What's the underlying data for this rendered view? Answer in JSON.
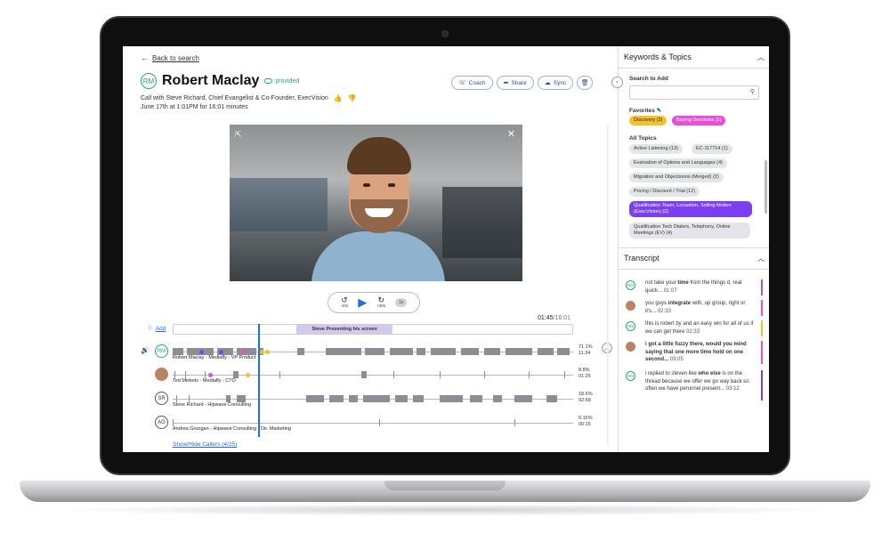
{
  "back": {
    "arrow": "←",
    "label": "Back to search"
  },
  "header": {
    "initials": "RM",
    "name": "Robert Maclay",
    "provided": "provided",
    "call_info": "Call with Steve Richard, Chief Evangelist & Co-Founder, ExecVision",
    "date_info": "June 17th at 1:01PM for 16:01 minutes",
    "thumbs_up": "👍",
    "thumbs_down": "👎"
  },
  "actions": {
    "coach": "Coach",
    "share": "Share",
    "sync": "Sync",
    "delete_icon": "🗑"
  },
  "player": {
    "back10": "-10s",
    "fwd30": "+30s",
    "speed": "1x",
    "current": "01:45",
    "total": "/16:01",
    "rewind_glyph": "↺",
    "forward_glyph": "↻",
    "play_glyph": "▶",
    "expand_glyph": "⇱",
    "close_glyph": "✕"
  },
  "timeline": {
    "add_label": "Add",
    "add_icon": "⚐",
    "segment_label": "Steve Presenting his screen",
    "show_hide": "Show/Hide Callers (4/25)",
    "collapse_glyph": "︿",
    "volume_glyph": "🔊"
  },
  "speakers": [
    {
      "initials": "RM",
      "name": "Robert Maclay - Mediafly - VP Product",
      "pct": "71.1%",
      "time": "11:24"
    },
    {
      "initials": "",
      "name": "Ted Minkels - Mediafly - CTO",
      "pct": "8.8%",
      "time": "01:25"
    },
    {
      "initials": "SR",
      "name": "Steve Richard - Hipwave Consulting",
      "pct": "18.6%",
      "time": "02:58"
    },
    {
      "initials": "AG",
      "name": "Andrea Groogan - Hipwave Consulting - Dir. Marketing",
      "pct": "0.15%",
      "time": "00:15"
    }
  ],
  "side": {
    "toggle_glyph": "‹",
    "kt_title": "Keywords & Topics",
    "caret": "︿",
    "search_label": "Search to Add",
    "search_placeholder": "",
    "search_glyph": "⚲",
    "favorites_label": "Favorites",
    "favorites_edit": "✎",
    "favorites": [
      "Discovery (3)",
      "Buying Decisions (2)"
    ],
    "all_topics_label": "All Topics",
    "topics": [
      "Active Listening (13)",
      "EC-117714 (1)",
      "Evaluation of Options and Languages (4)",
      "Migration and Objectsions (Merged) (2)",
      "Pricing / Discount / Trial (12)",
      "Qualification Team, Locaation, Selling Motion (ExecVision) (2)",
      "Qualification Tech Dialers, Telephony, Online Meetings (EV) (4)"
    ],
    "transcript_title": "Transcript",
    "transcript": [
      {
        "initials": "RM",
        "pre": "not take your ",
        "bold": "time",
        "post": " from the things d, real quick...",
        "time": "01:07",
        "color": "#9b59e8"
      },
      {
        "initials": "",
        "pre": "you guys ",
        "bold": "integrate",
        "post": " with, up group, right or it's...",
        "time": "02:33",
        "color": "#e74fd4"
      },
      {
        "initials": "RM",
        "pre": "this is robert by and an easy win for all of us if we can get there",
        "bold": "",
        "post": "",
        "time": "02:33",
        "color": "#f3c234"
      },
      {
        "initials": "",
        "pre": "",
        "bold": "i got a little fuzzy there, would you mind saying that one more time hold on one second...",
        "post": "",
        "time": "03:05",
        "color": "#e74fd4"
      },
      {
        "initials": "RM",
        "pre": "i replied to steven like ",
        "bold": "who else",
        "post": " is on the thread because we offer we go way back so often we have peronnel present...",
        "time": "03:12",
        "color": "#7b3ff2"
      }
    ]
  },
  "colors": {
    "accent": "#1e6fd8",
    "green": "#2aa86b",
    "yellow": "#f3c234",
    "pink": "#e74fd4",
    "purple": "#7b3ff2"
  }
}
